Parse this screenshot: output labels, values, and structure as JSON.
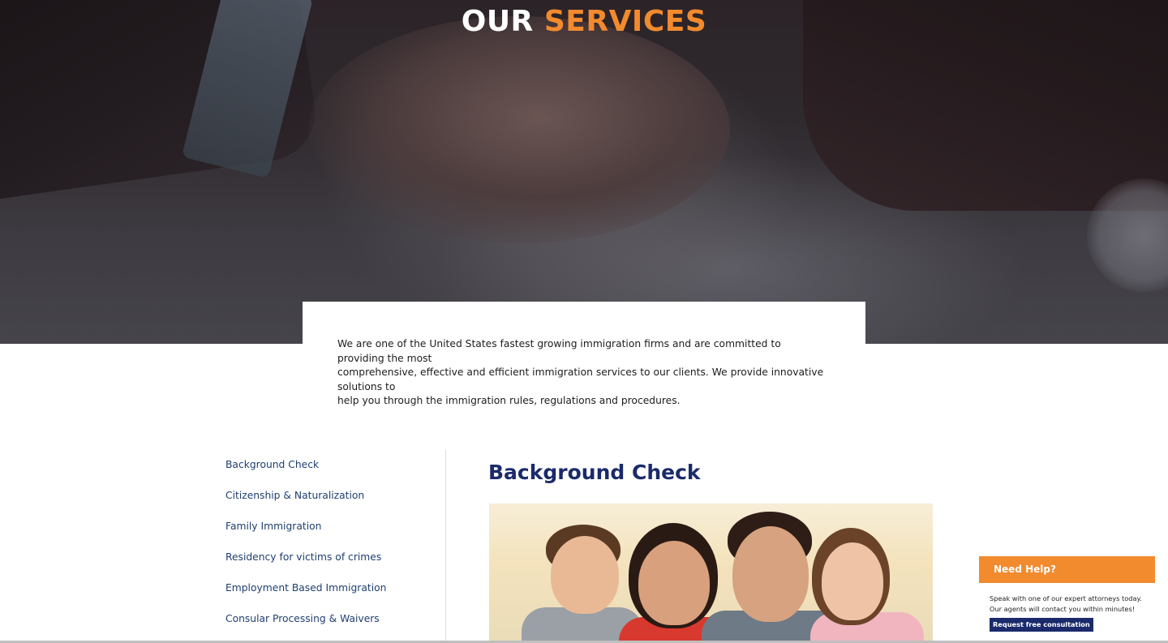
{
  "hero": {
    "title_white": "OUR",
    "title_accent": "SERVICES",
    "title_color": "#ffffff",
    "accent_color": "#f28a2e"
  },
  "intro": {
    "line1": "We are one of the United States fastest growing immigration firms and are committed to providing the most",
    "line2": "comprehensive, effective and efficient immigration services to our clients. We provide innovative solutions to",
    "line3": "help you through the immigration rules, regulations and procedures."
  },
  "sidebar": {
    "items": [
      {
        "label": "Background Check"
      },
      {
        "label": "Citizenship & Naturalization"
      },
      {
        "label": "Family Immigration"
      },
      {
        "label": "Residency for victims of crimes"
      },
      {
        "label": "Employment Based Immigration"
      },
      {
        "label": "Consular Processing & Waivers"
      }
    ],
    "link_color": "#1f3f6e"
  },
  "main": {
    "title": "Background Check",
    "title_color": "#1b2a6b",
    "image_icon": "family-photo"
  },
  "help": {
    "heading": "Need Help?",
    "line1": "Speak with one of our expert attorneys today.",
    "line2": "Our agents will contact you within minutes!",
    "button": "Request free consultation",
    "header_color": "#f28a2e",
    "button_color": "#1b2a6b"
  }
}
